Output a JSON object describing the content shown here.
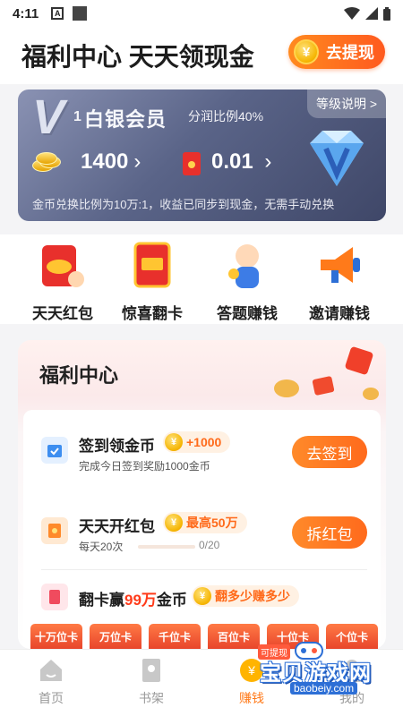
{
  "status_bar": {
    "time": "4:11",
    "a_badge": "A"
  },
  "header": {
    "title": "福利中心 天天领现金",
    "withdraw_label": "去提现",
    "coin_symbol": "¥"
  },
  "vip": {
    "badge_letter": "V",
    "badge_num": "1",
    "level": "白银会员",
    "ratio": "分润比例40%",
    "level_tab": "等级说明 >",
    "coins": "1400",
    "cash": "0.01",
    "chevron": "›",
    "note": "金币兑换比例为10万:1，收益已同步到现金，无需手动兑换"
  },
  "features": [
    {
      "label": "天天红包",
      "icon": "red-envelope-icon"
    },
    {
      "label": "惊喜翻卡",
      "icon": "flip-card-icon"
    },
    {
      "label": "答题赚钱",
      "icon": "quiz-character-icon"
    },
    {
      "label": "邀请赚钱",
      "icon": "megaphone-icon"
    }
  ],
  "welfare": {
    "title": "福利中心",
    "tasks": [
      {
        "name": "签到领金币",
        "reward": "+1000",
        "sub": "完成今日签到奖励1000金币",
        "button": "去签到"
      },
      {
        "name": "天天开红包",
        "reward": "最高50万",
        "sub": "每天20次",
        "progress_text": "0/20",
        "progress": 0,
        "button": "拆红包"
      },
      {
        "name_prefix": "翻卡赢",
        "name_highlight": "99万",
        "name_suffix": "金币",
        "reward": "翻多少赚多少"
      }
    ],
    "card_tabs": [
      "十万位卡",
      "万位卡",
      "千位卡",
      "百位卡",
      "十位卡",
      "个位卡"
    ]
  },
  "nav": [
    {
      "label": "首页",
      "icon": "home-icon",
      "active": false
    },
    {
      "label": "书架",
      "icon": "bookshelf-icon",
      "active": false
    },
    {
      "label": "赚钱",
      "icon": "coin-icon",
      "active": true
    },
    {
      "label": "我的",
      "icon": "profile-icon",
      "active": false
    }
  ],
  "watermark": {
    "text": "宝贝游戏网",
    "url": "baobeiy.com",
    "tag": "可提现"
  },
  "colors": {
    "accent": "#ff7a1a",
    "vip_bg": "#5a6488",
    "red": "#e8302c"
  }
}
